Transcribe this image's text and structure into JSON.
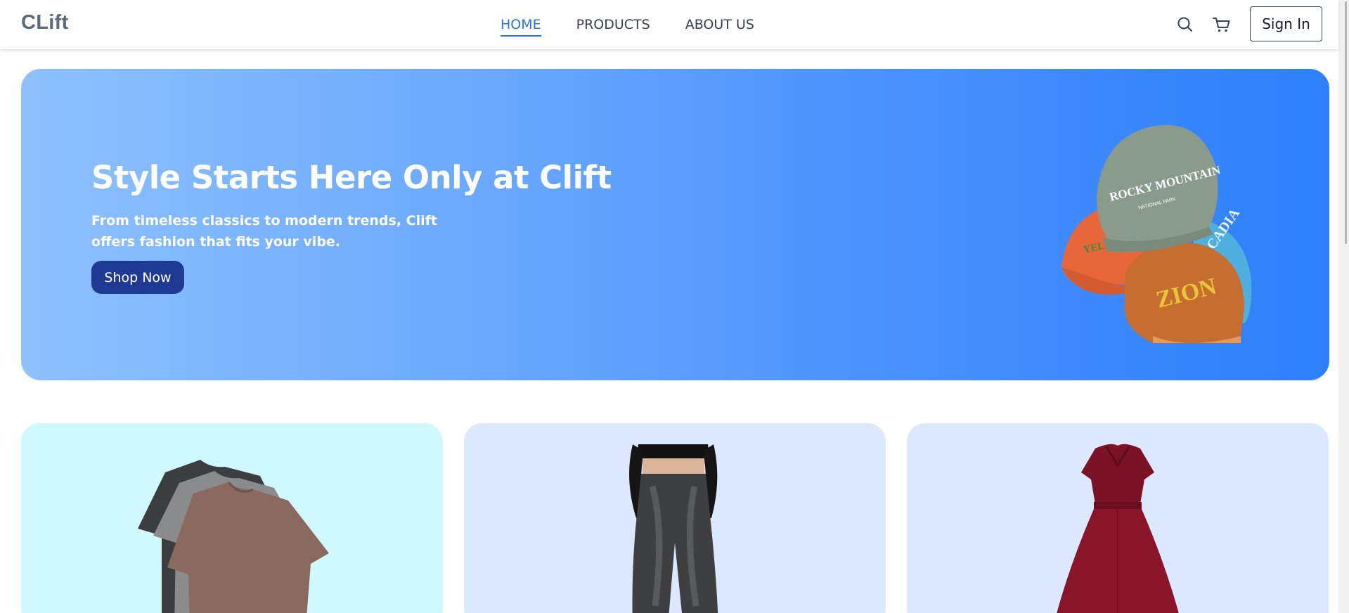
{
  "brand": {
    "logo": "CLift"
  },
  "nav": {
    "items": [
      {
        "label": "HOME",
        "active": true
      },
      {
        "label": "PRODUCTS",
        "active": false
      },
      {
        "label": "ABOUT US",
        "active": false
      }
    ]
  },
  "header_actions": {
    "search_icon": "search-icon",
    "cart_icon": "cart-icon",
    "signin_label": "Sign In"
  },
  "hero": {
    "title": "Style Starts Here Only at Clift",
    "subtitle": "From timeless classics to modern trends, Clift offers fashion that fits your vibe.",
    "cta_label": "Shop Now",
    "cap_texts": [
      "ROCKY MOUNTAIN",
      "NATIONAL PARK",
      "ZION",
      "YELLOWSTONE",
      "ACADIA"
    ]
  },
  "categories": [
    {
      "image": "t-shirts"
    },
    {
      "image": "jeans"
    },
    {
      "image": "dress"
    }
  ],
  "colors": {
    "accent": "#2b74e0",
    "cta": "#1f3a93",
    "hero_from": "#8ec1fd",
    "hero_to": "#2d7ffb",
    "card_cyan": "#cff9fe",
    "card_blue": "#dbe8fe"
  }
}
